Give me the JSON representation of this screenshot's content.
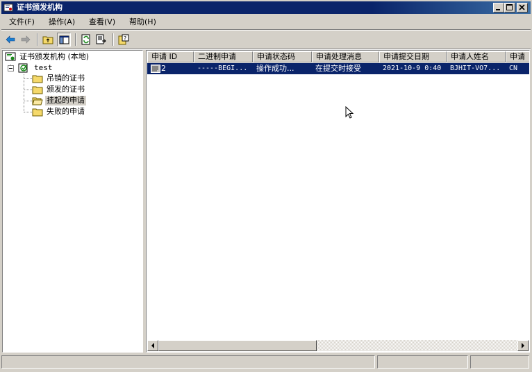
{
  "window": {
    "title": "证书颁发机构",
    "controls": [
      "minimize-icon",
      "maximize-icon",
      "close-icon"
    ]
  },
  "menu": [
    "文件(F)",
    "操作(A)",
    "查看(V)",
    "帮助(H)"
  ],
  "toolbar": [
    "back-arrow-icon",
    "forward-arrow-icon",
    "up-folder-icon",
    "show-hide-tree-icon",
    "refresh-icon",
    "export-list-icon",
    "help-icon"
  ],
  "tree": {
    "root": "证书颁发机构 (本地)",
    "ca": "test",
    "folders": [
      {
        "label": "吊销的证书",
        "selected": false
      },
      {
        "label": "颁发的证书",
        "selected": false
      },
      {
        "label": "挂起的申请",
        "selected": true
      },
      {
        "label": "失败的申请",
        "selected": false
      }
    ]
  },
  "list": {
    "columns": [
      "申请 ID",
      "二进制申请",
      "申请状态码",
      "申请处理消息",
      "申请提交日期",
      "申请人姓名",
      "申请"
    ],
    "rows": [
      [
        "2",
        "-----BEGI...",
        "操作成功...",
        "在提交时接受",
        "2021-10-9 0:40",
        "BJHIT-VO7...",
        "CN"
      ]
    ],
    "selected_row": 0
  },
  "colors": {
    "titlebar": "#0a246a",
    "selection": "#0a246a",
    "face": "#d4d0c8"
  }
}
